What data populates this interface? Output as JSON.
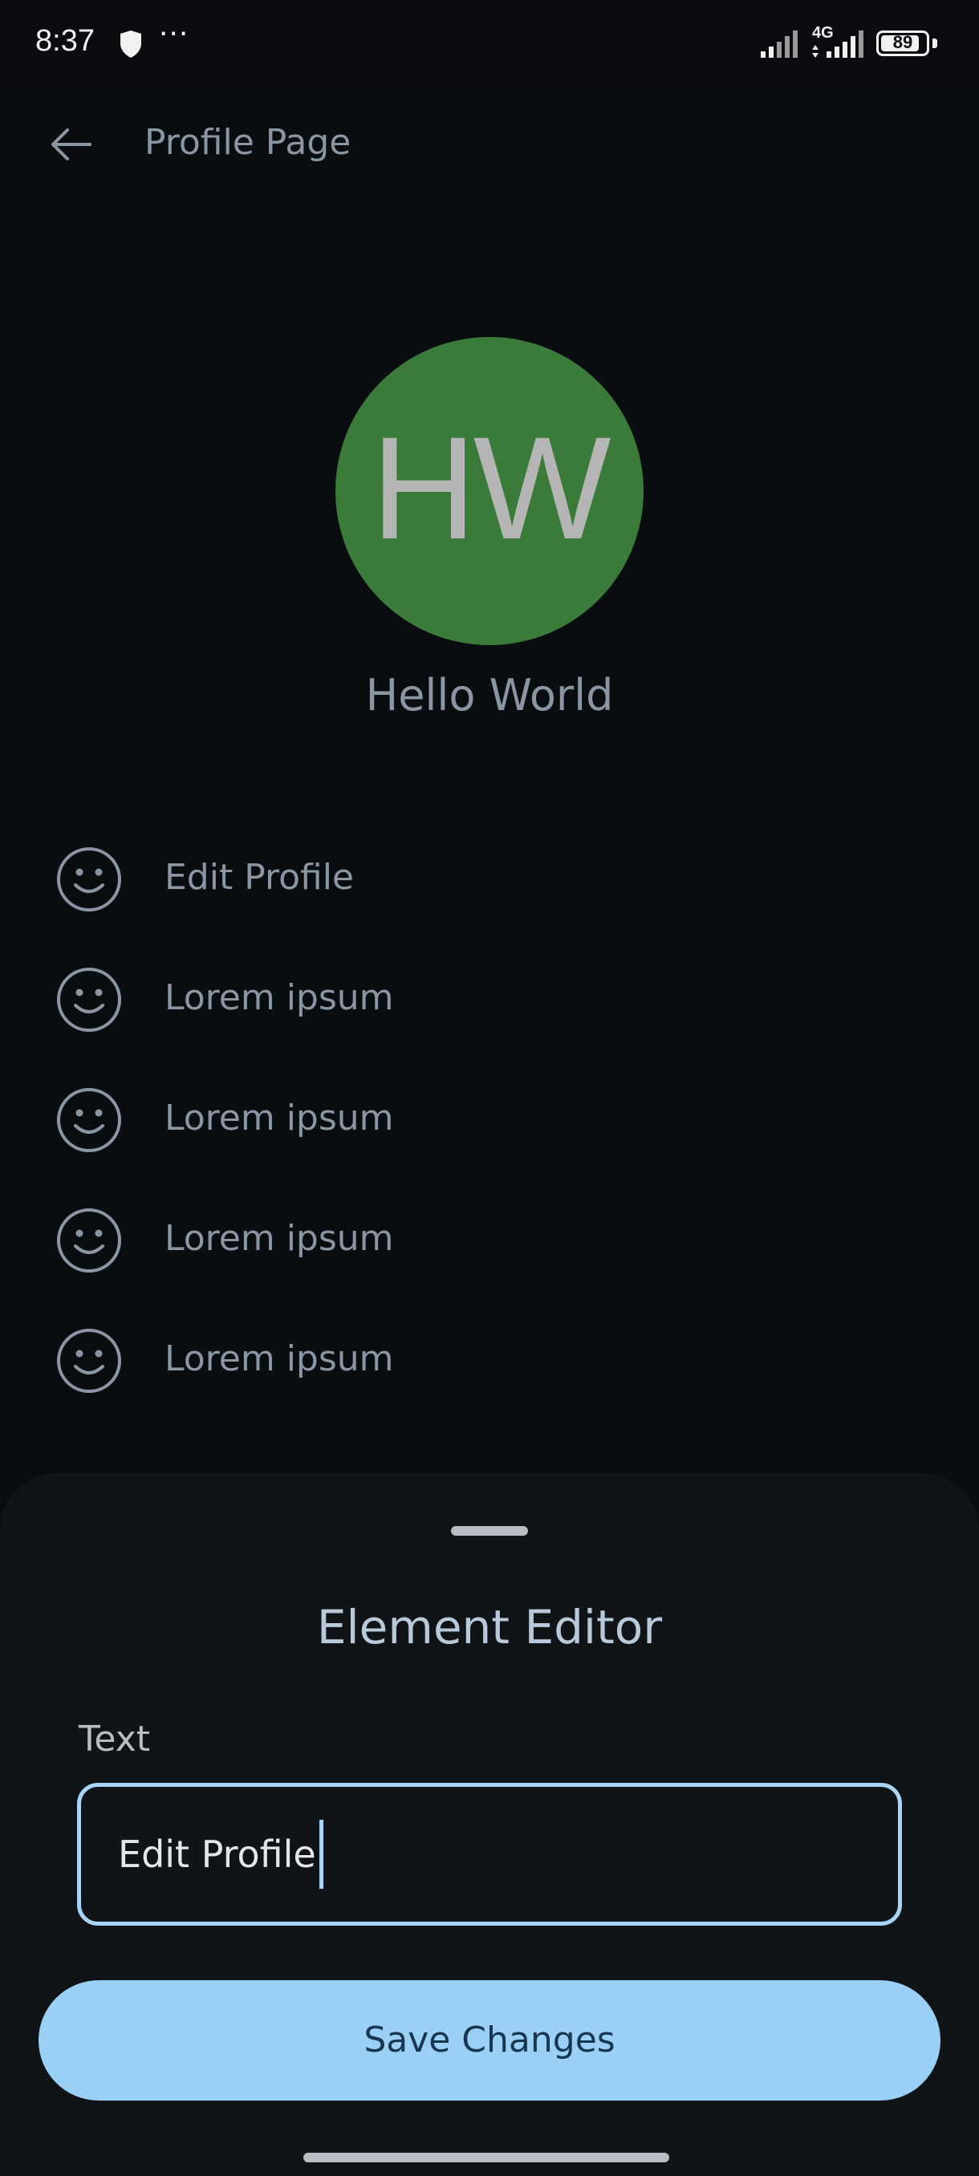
{
  "status_bar": {
    "time": "8:37",
    "dots": "···",
    "network": "4G",
    "battery": "89",
    "battery_level": 0.89
  },
  "header": {
    "back_icon": "arrow-left-icon",
    "title": "Profile Page"
  },
  "profile": {
    "initials": "HW",
    "name": "Hello World",
    "avatar_color": "#3a7b3a"
  },
  "menu": {
    "icon": "smiley-face-icon",
    "items": [
      {
        "label": "Edit Profile"
      },
      {
        "label": "Lorem ipsum"
      },
      {
        "label": "Lorem ipsum"
      },
      {
        "label": "Lorem ipsum"
      },
      {
        "label": "Lorem ipsum"
      }
    ]
  },
  "editor": {
    "title": "Element Editor",
    "field_label": "Text",
    "field_value": "Edit Profile",
    "save_label": "Save Changes",
    "accent_color": "#9bd0f6"
  }
}
